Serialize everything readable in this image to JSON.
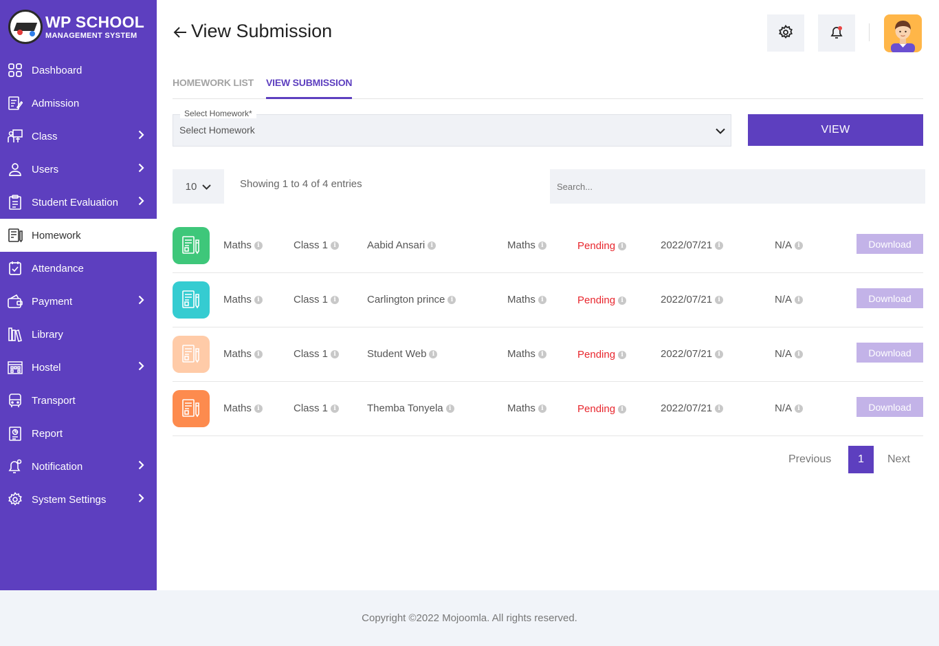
{
  "brand": {
    "title": "WP SCHOOL",
    "subtitle": "MANAGEMENT SYSTEM"
  },
  "sidebar": {
    "items": [
      {
        "label": "Dashboard",
        "icon": "dashboard-icon",
        "has_chevron": false,
        "active": false
      },
      {
        "label": "Admission",
        "icon": "admission-icon",
        "has_chevron": false,
        "active": false
      },
      {
        "label": "Class",
        "icon": "class-icon",
        "has_chevron": true,
        "active": false
      },
      {
        "label": "Users",
        "icon": "user-icon",
        "has_chevron": true,
        "active": false
      },
      {
        "label": "Student Evaluation",
        "icon": "clipboard-icon",
        "has_chevron": true,
        "active": false
      },
      {
        "label": "Homework",
        "icon": "homework-icon",
        "has_chevron": false,
        "active": true
      },
      {
        "label": "Attendance",
        "icon": "attendance-check-icon",
        "has_chevron": false,
        "active": false
      },
      {
        "label": "Payment",
        "icon": "wallet-icon",
        "has_chevron": true,
        "active": false
      },
      {
        "label": "Library",
        "icon": "library-icon",
        "has_chevron": false,
        "active": false
      },
      {
        "label": "Hostel",
        "icon": "hostel-icon",
        "has_chevron": true,
        "active": false
      },
      {
        "label": "Transport",
        "icon": "bus-icon",
        "has_chevron": false,
        "active": false
      },
      {
        "label": "Report",
        "icon": "report-icon",
        "has_chevron": false,
        "active": false
      },
      {
        "label": "Notification",
        "icon": "notification-icon",
        "has_chevron": true,
        "active": false
      },
      {
        "label": "System Settings",
        "icon": "gear-icon",
        "has_chevron": true,
        "active": false
      }
    ]
  },
  "header": {
    "title": "View Submission"
  },
  "tabs": {
    "homework_list": "HOMEWORK LIST",
    "view_submission": "VIEW SUBMISSION"
  },
  "filter": {
    "label": "Select Homework*",
    "value": "Select Homework",
    "view_button": "VIEW"
  },
  "table_controls": {
    "page_length": "10",
    "showing": "Showing 1 to 4 of 4 entries",
    "search_placeholder": "Search..."
  },
  "rows": [
    {
      "icon_color": "#3ec77a",
      "homework": "Maths",
      "class": "Class 1",
      "student": "Aabid Ansari",
      "subject": "Maths",
      "status": "Pending",
      "date": "2022/07/21",
      "evaluation": "N/A",
      "action": "Download"
    },
    {
      "icon_color": "#35ccd1",
      "homework": "Maths",
      "class": "Class 1",
      "student": "Carlington prince",
      "subject": "Maths",
      "status": "Pending",
      "date": "2022/07/21",
      "evaluation": "N/A",
      "action": "Download"
    },
    {
      "icon_color": "#ffcba8",
      "homework": "Maths",
      "class": "Class 1",
      "student": "Student Web",
      "subject": "Maths",
      "status": "Pending",
      "date": "2022/07/21",
      "evaluation": "N/A",
      "action": "Download"
    },
    {
      "icon_color": "#fd8b4e",
      "homework": "Maths",
      "class": "Class 1",
      "student": "Themba Tonyela",
      "subject": "Maths",
      "status": "Pending",
      "date": "2022/07/21",
      "evaluation": "N/A",
      "action": "Download"
    }
  ],
  "pagination": {
    "previous": "Previous",
    "current": "1",
    "next": "Next"
  },
  "footer": {
    "copyright": "Copyright ©2022 Mojoomla. All rights reserved."
  },
  "colors": {
    "primary": "#5d3fbf",
    "status_pending": "#e8262d",
    "download_button": "#c3b3e8"
  }
}
